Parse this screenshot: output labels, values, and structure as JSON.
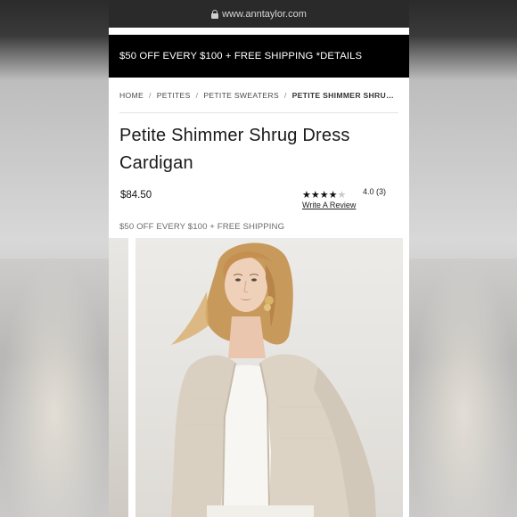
{
  "browser": {
    "url": "www.anntaylor.com"
  },
  "promo": {
    "banner_text": "$50 OFF EVERY $100 + FREE SHIPPING *DETAILS"
  },
  "breadcrumb": [
    {
      "label": "HOME"
    },
    {
      "label": "PETITES"
    },
    {
      "label": "PETITE SWEATERS"
    },
    {
      "label": "PETITE SHIMMER SHRUG D..."
    }
  ],
  "product": {
    "title_line1": "Petite Shimmer Shrug Dress",
    "title_line2": "Cardigan",
    "price": "$84.50",
    "rating": {
      "stars_filled": 4,
      "stars_total": 5,
      "value_text": "4.0  (3)",
      "review_link": "Write A Review"
    },
    "shipping_note": "$50 OFF EVERY $100 + FREE SHIPPING"
  },
  "colors": {
    "banner_bg": "#000000",
    "url_bar_bg": "#2a2a2a",
    "cardigan": "#d9d0c2",
    "hair": "#c99a5a"
  },
  "gallery": {
    "icons": [
      "product-photo"
    ]
  }
}
